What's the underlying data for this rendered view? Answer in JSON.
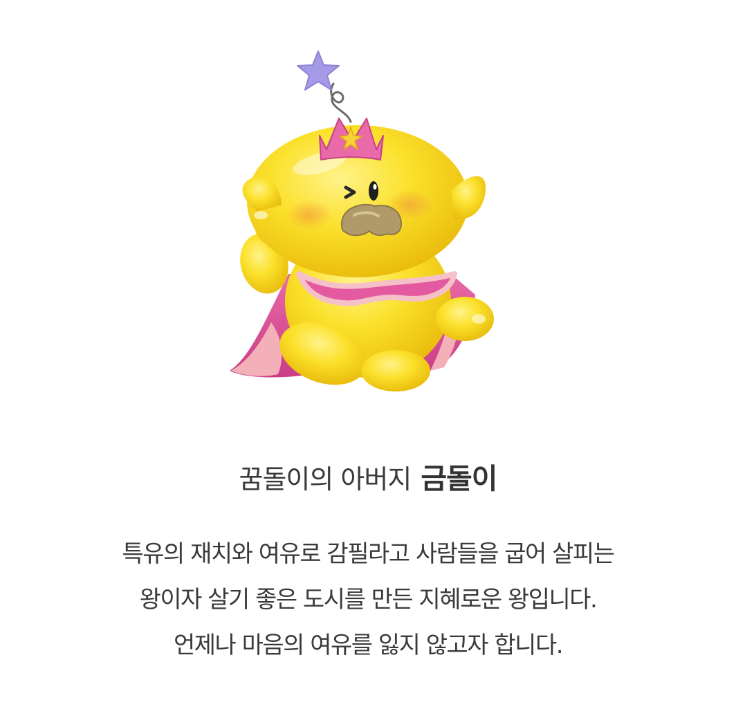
{
  "character": {
    "image_subject": "yellow-king-character"
  },
  "intro": {
    "prefix": "꿈돌이의 아버지",
    "name": "금돌이"
  },
  "description": {
    "lines": [
      "특유의 재치와 여유로 감필라고 사람들을 굽어 살피는",
      "왕이자 살기 좋은 도시를 만든 지혜로운 왕입니다.",
      "언제나 마음의 여유를 잃지 않고자 합니다."
    ]
  },
  "colors": {
    "body_yellow": "#f7d21c",
    "cape_pink": "#e0569a",
    "crown_pink": "#e86aa8",
    "star_lavender": "#a59ae6",
    "text": "#3a3a3a"
  }
}
